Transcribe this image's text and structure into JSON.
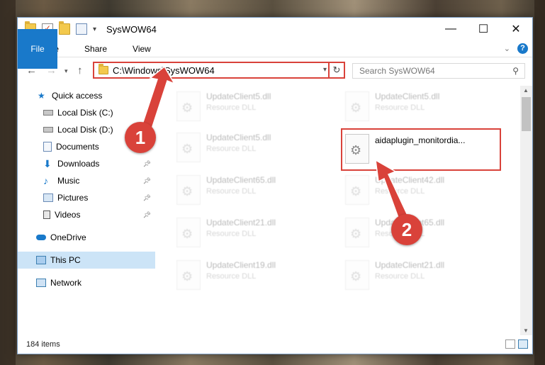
{
  "window": {
    "title": "SysWOW64",
    "controls": {
      "minimize": "—",
      "maximize": "☐",
      "close": "✕"
    }
  },
  "ribbon": {
    "tabs": [
      "File",
      "Home",
      "Share",
      "View"
    ],
    "help": "?"
  },
  "address": {
    "path": "C:\\Windows\\SysWOW64",
    "search_placeholder": "Search SysWOW64"
  },
  "sidebar": {
    "items": [
      {
        "label": "Quick access",
        "icon": "star-icon"
      },
      {
        "label": "Local Disk (C:)",
        "icon": "drive-icon"
      },
      {
        "label": "Local Disk (D:)",
        "icon": "drive-icon"
      },
      {
        "label": "Documents",
        "icon": "documents-icon"
      },
      {
        "label": "Downloads",
        "icon": "download-icon"
      },
      {
        "label": "Music",
        "icon": "music-icon"
      },
      {
        "label": "Pictures",
        "icon": "pictures-icon"
      },
      {
        "label": "Videos",
        "icon": "videos-icon"
      },
      {
        "label": "OneDrive",
        "icon": "cloud-icon"
      },
      {
        "label": "This PC",
        "icon": "computer-icon"
      },
      {
        "label": "Network",
        "icon": "network-icon"
      }
    ]
  },
  "files": [
    {
      "name": "UpdateClient5.dll",
      "type": "Resource DLL"
    },
    {
      "name": "UpdateClient5.dll",
      "type": "Resource DLL"
    },
    {
      "name": "UpdateClient5.dll",
      "type": "Resource DLL"
    },
    {
      "name": "aidaplugin_monitordia...",
      "type": ""
    },
    {
      "name": "UpdateClient65.dll",
      "type": "Resource DLL"
    },
    {
      "name": "UpdateClient42.dll",
      "type": "Resource DLL"
    },
    {
      "name": "UpdateClient21.dll",
      "type": "Resource DLL"
    },
    {
      "name": "UpdateClient65.dll",
      "type": "Resource DLL"
    },
    {
      "name": "UpdateClient19.dll",
      "type": "Resource DLL"
    },
    {
      "name": "UpdateClient21.dll",
      "type": "Resource DLL"
    }
  ],
  "status": {
    "count": "184 items"
  },
  "callouts": {
    "one": "1",
    "two": "2"
  },
  "colors": {
    "accent": "#1979ca",
    "highlight": "#d9423a",
    "selected": "#cce4f7"
  }
}
